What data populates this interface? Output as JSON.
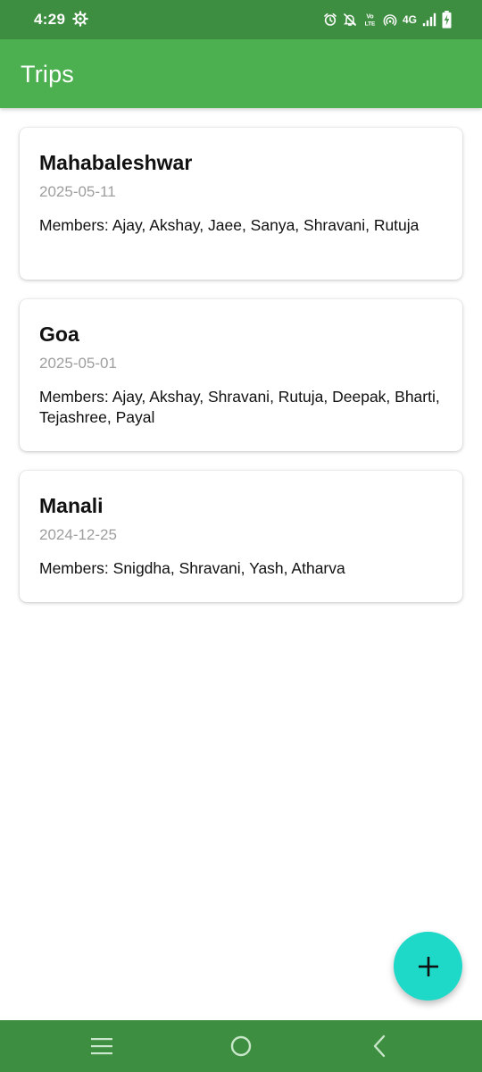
{
  "status_bar": {
    "time": "4:29",
    "network": "4G",
    "icons": [
      "settings-icon",
      "alarm-icon",
      "notifications-off-icon",
      "volte-icon",
      "hotspot-icon",
      "signal-icon",
      "battery-charging-icon"
    ]
  },
  "app_bar": {
    "title": "Trips"
  },
  "trips": [
    {
      "name": "Mahabaleshwar",
      "date": "2025-05-11",
      "members": "Members: Ajay, Akshay, Jaee, Sanya, Shravani, Rutuja"
    },
    {
      "name": "Goa",
      "date": "2025-05-01",
      "members": "Members: Ajay, Akshay, Shravani, Rutuja, Deepak, Bharti, Tejashree, Payal"
    },
    {
      "name": "Manali",
      "date": "2024-12-25",
      "members": "Members: Snigdha, Shravani, Yash, Atharva"
    }
  ],
  "fab": {
    "icon": "plus-icon"
  },
  "nav_bar": {
    "icons": [
      "recent-apps-icon",
      "home-icon",
      "back-icon"
    ]
  },
  "colors": {
    "status_bar": "#3e8e41",
    "app_bar": "#4caf50",
    "fab": "#1ed8c8",
    "date_text": "#9e9e9e"
  }
}
